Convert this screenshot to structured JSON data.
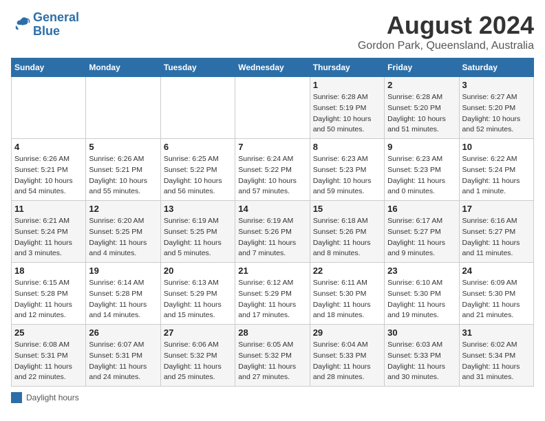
{
  "header": {
    "logo_line1": "General",
    "logo_line2": "Blue",
    "title": "August 2024",
    "subtitle": "Gordon Park, Queensland, Australia"
  },
  "columns": [
    "Sunday",
    "Monday",
    "Tuesday",
    "Wednesday",
    "Thursday",
    "Friday",
    "Saturday"
  ],
  "legend": {
    "label": "Daylight hours"
  },
  "weeks": [
    {
      "days": [
        {
          "num": "",
          "info": ""
        },
        {
          "num": "",
          "info": ""
        },
        {
          "num": "",
          "info": ""
        },
        {
          "num": "",
          "info": ""
        },
        {
          "num": "1",
          "info": "Sunrise: 6:28 AM\nSunset: 5:19 PM\nDaylight: 10 hours\nand 50 minutes."
        },
        {
          "num": "2",
          "info": "Sunrise: 6:28 AM\nSunset: 5:20 PM\nDaylight: 10 hours\nand 51 minutes."
        },
        {
          "num": "3",
          "info": "Sunrise: 6:27 AM\nSunset: 5:20 PM\nDaylight: 10 hours\nand 52 minutes."
        }
      ]
    },
    {
      "days": [
        {
          "num": "4",
          "info": "Sunrise: 6:26 AM\nSunset: 5:21 PM\nDaylight: 10 hours\nand 54 minutes."
        },
        {
          "num": "5",
          "info": "Sunrise: 6:26 AM\nSunset: 5:21 PM\nDaylight: 10 hours\nand 55 minutes."
        },
        {
          "num": "6",
          "info": "Sunrise: 6:25 AM\nSunset: 5:22 PM\nDaylight: 10 hours\nand 56 minutes."
        },
        {
          "num": "7",
          "info": "Sunrise: 6:24 AM\nSunset: 5:22 PM\nDaylight: 10 hours\nand 57 minutes."
        },
        {
          "num": "8",
          "info": "Sunrise: 6:23 AM\nSunset: 5:23 PM\nDaylight: 10 hours\nand 59 minutes."
        },
        {
          "num": "9",
          "info": "Sunrise: 6:23 AM\nSunset: 5:23 PM\nDaylight: 11 hours\nand 0 minutes."
        },
        {
          "num": "10",
          "info": "Sunrise: 6:22 AM\nSunset: 5:24 PM\nDaylight: 11 hours\nand 1 minute."
        }
      ]
    },
    {
      "days": [
        {
          "num": "11",
          "info": "Sunrise: 6:21 AM\nSunset: 5:24 PM\nDaylight: 11 hours\nand 3 minutes."
        },
        {
          "num": "12",
          "info": "Sunrise: 6:20 AM\nSunset: 5:25 PM\nDaylight: 11 hours\nand 4 minutes."
        },
        {
          "num": "13",
          "info": "Sunrise: 6:19 AM\nSunset: 5:25 PM\nDaylight: 11 hours\nand 5 minutes."
        },
        {
          "num": "14",
          "info": "Sunrise: 6:19 AM\nSunset: 5:26 PM\nDaylight: 11 hours\nand 7 minutes."
        },
        {
          "num": "15",
          "info": "Sunrise: 6:18 AM\nSunset: 5:26 PM\nDaylight: 11 hours\nand 8 minutes."
        },
        {
          "num": "16",
          "info": "Sunrise: 6:17 AM\nSunset: 5:27 PM\nDaylight: 11 hours\nand 9 minutes."
        },
        {
          "num": "17",
          "info": "Sunrise: 6:16 AM\nSunset: 5:27 PM\nDaylight: 11 hours\nand 11 minutes."
        }
      ]
    },
    {
      "days": [
        {
          "num": "18",
          "info": "Sunrise: 6:15 AM\nSunset: 5:28 PM\nDaylight: 11 hours\nand 12 minutes."
        },
        {
          "num": "19",
          "info": "Sunrise: 6:14 AM\nSunset: 5:28 PM\nDaylight: 11 hours\nand 14 minutes."
        },
        {
          "num": "20",
          "info": "Sunrise: 6:13 AM\nSunset: 5:29 PM\nDaylight: 11 hours\nand 15 minutes."
        },
        {
          "num": "21",
          "info": "Sunrise: 6:12 AM\nSunset: 5:29 PM\nDaylight: 11 hours\nand 17 minutes."
        },
        {
          "num": "22",
          "info": "Sunrise: 6:11 AM\nSunset: 5:30 PM\nDaylight: 11 hours\nand 18 minutes."
        },
        {
          "num": "23",
          "info": "Sunrise: 6:10 AM\nSunset: 5:30 PM\nDaylight: 11 hours\nand 19 minutes."
        },
        {
          "num": "24",
          "info": "Sunrise: 6:09 AM\nSunset: 5:30 PM\nDaylight: 11 hours\nand 21 minutes."
        }
      ]
    },
    {
      "days": [
        {
          "num": "25",
          "info": "Sunrise: 6:08 AM\nSunset: 5:31 PM\nDaylight: 11 hours\nand 22 minutes."
        },
        {
          "num": "26",
          "info": "Sunrise: 6:07 AM\nSunset: 5:31 PM\nDaylight: 11 hours\nand 24 minutes."
        },
        {
          "num": "27",
          "info": "Sunrise: 6:06 AM\nSunset: 5:32 PM\nDaylight: 11 hours\nand 25 minutes."
        },
        {
          "num": "28",
          "info": "Sunrise: 6:05 AM\nSunset: 5:32 PM\nDaylight: 11 hours\nand 27 minutes."
        },
        {
          "num": "29",
          "info": "Sunrise: 6:04 AM\nSunset: 5:33 PM\nDaylight: 11 hours\nand 28 minutes."
        },
        {
          "num": "30",
          "info": "Sunrise: 6:03 AM\nSunset: 5:33 PM\nDaylight: 11 hours\nand 30 minutes."
        },
        {
          "num": "31",
          "info": "Sunrise: 6:02 AM\nSunset: 5:34 PM\nDaylight: 11 hours\nand 31 minutes."
        }
      ]
    }
  ]
}
